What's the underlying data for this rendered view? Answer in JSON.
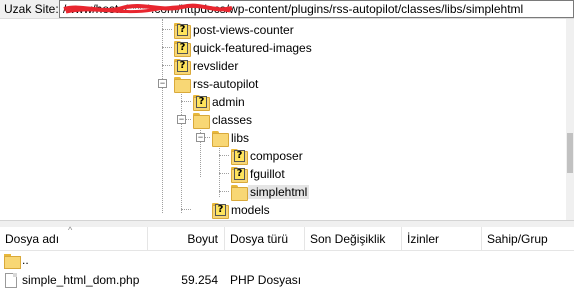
{
  "address_bar": {
    "label": "Uzak Site:",
    "path": "/www/hosts/*****.com/httpdocs/wp-content/plugins/rss-autopilot/classes/libs/simplehtml"
  },
  "tree": {
    "items": [
      {
        "label": "post-views-counter",
        "icon": "unknown-folder-icon"
      },
      {
        "label": "quick-featured-images",
        "icon": "unknown-folder-icon"
      },
      {
        "label": "revslider",
        "icon": "unknown-folder-icon"
      },
      {
        "label": "rss-autopilot",
        "icon": "folder-icon",
        "toggle": "−"
      },
      {
        "label": "admin",
        "icon": "unknown-folder-icon"
      },
      {
        "label": "classes",
        "icon": "folder-icon",
        "toggle": "−"
      },
      {
        "label": "libs",
        "icon": "folder-icon",
        "toggle": "−"
      },
      {
        "label": "composer",
        "icon": "unknown-folder-icon"
      },
      {
        "label": "fguillot",
        "icon": "unknown-folder-icon"
      },
      {
        "label": "simplehtml",
        "icon": "folder-icon",
        "selected": true
      },
      {
        "label": "models",
        "icon": "unknown-folder-icon"
      }
    ]
  },
  "file_list": {
    "columns": [
      "Dosya adı",
      "Boyut",
      "Dosya türü",
      "Son Değişiklik",
      "İzinler",
      "Sahip/Grup"
    ],
    "rows": [
      {
        "name": "..",
        "size": "",
        "type": "",
        "icon": "parent-folder-icon"
      },
      {
        "name": "simple_html_dom.php",
        "size": "59.254",
        "type": "PHP Dosyası",
        "icon": "php-file-icon"
      }
    ]
  },
  "colors": {
    "folder": "#f8d775",
    "selection": "#e5e5e5"
  }
}
